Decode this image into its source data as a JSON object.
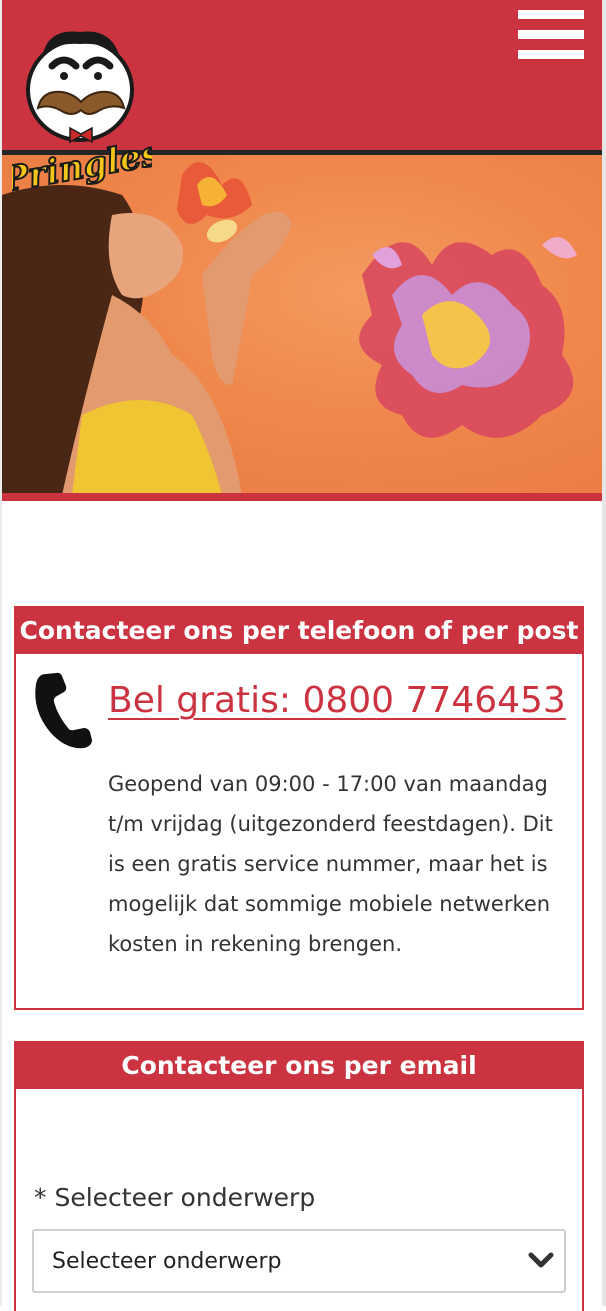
{
  "header": {
    "logo_text": "Pringles",
    "menu_icon": "hamburger-icon",
    "brand_color": "#cc3340"
  },
  "hero": {
    "image": "woman eating Pringles chip with flavor flames"
  },
  "phone_card": {
    "title": "Contacteer ons per telefoon of per post",
    "icon": "phone-icon",
    "phone_link": "Bel gratis: 0800 7746453",
    "description": "Geopend van 09:00 - 17:00 van maandag t/m vrijdag (uitgezonderd feestdagen). Dit is een gratis service nummer, maar het is mogelijk dat sommige mobiele netwerken kosten in rekening brengen."
  },
  "email_card": {
    "title": "Contacteer ons per email",
    "subject_label": "* Selecteer onderwerp",
    "subject_select_value": "Selecteer onderwerp"
  }
}
